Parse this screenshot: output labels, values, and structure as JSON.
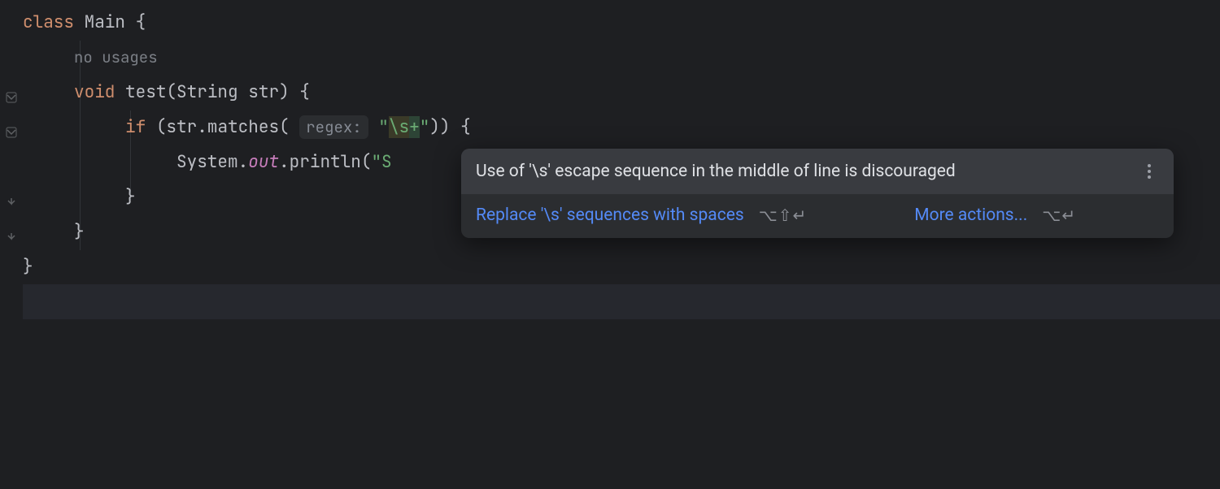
{
  "code": {
    "kw_class": "class",
    "class_name": "Main",
    "brace_open": "{",
    "brace_close": "}",
    "no_usages": "no usages",
    "kw_void": "void",
    "method_name": "test",
    "param_type": "String",
    "param_name": "str",
    "kw_if": "if",
    "call_target": "str",
    "call_method": "matches",
    "param_hint": "regex:",
    "string_open": "\"",
    "escape_seq": "\\s",
    "regex_plus": "+",
    "string_close": "\"",
    "paren_open": "(",
    "paren_close": ")",
    "println_qualifier": "System",
    "println_field": "out",
    "println_method": "println",
    "println_arg_start": "\"S"
  },
  "popup": {
    "title": "Use of '\\s' escape sequence in the middle of line is discouraged",
    "action_replace": "Replace '\\s' sequences with spaces",
    "shortcut_replace": "⌥⇧↵",
    "action_more": "More actions...",
    "shortcut_more": "⌥↵"
  }
}
